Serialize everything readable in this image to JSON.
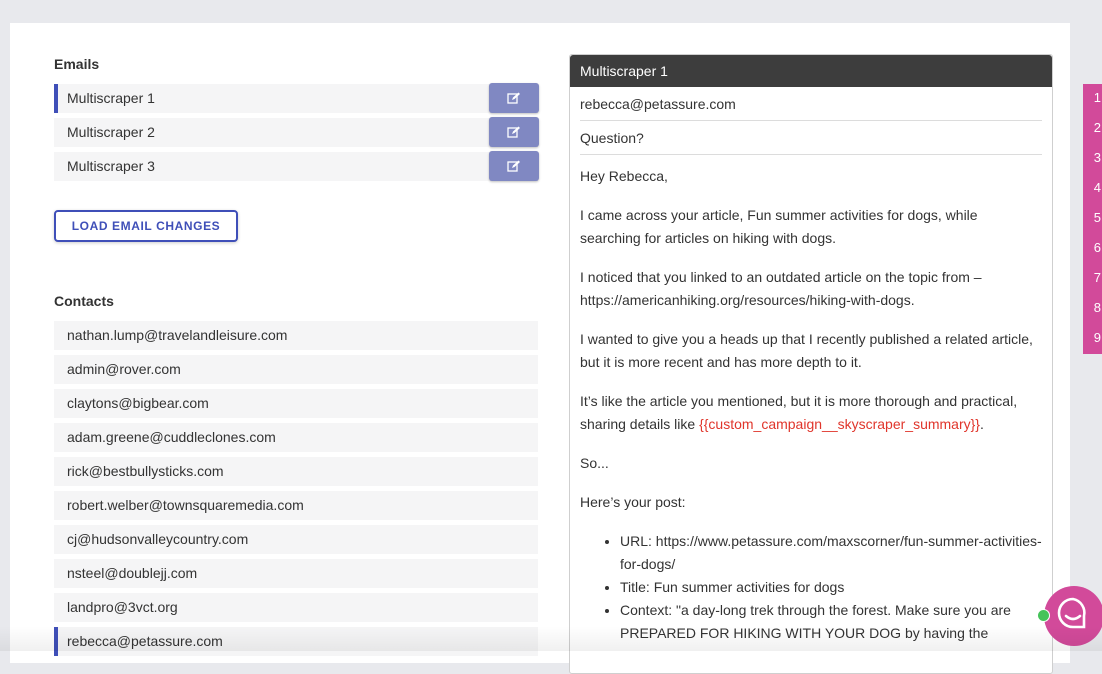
{
  "emails": {
    "title": "Emails",
    "items": [
      {
        "label": "Multiscraper 1"
      },
      {
        "label": "Multiscraper 2"
      },
      {
        "label": "Multiscraper 3"
      }
    ],
    "load_button": "LOAD EMAIL CHANGES"
  },
  "contacts": {
    "title": "Contacts",
    "items": [
      "nathan.lump@travelandleisure.com",
      "admin@rover.com",
      "claytons@bigbear.com",
      "adam.greene@cuddleclones.com",
      "rick@bestbullysticks.com",
      "robert.welber@townsquaremedia.com",
      "cj@hudsonvalleycountry.com",
      "nsteel@doublejj.com",
      "landpro@3vct.org",
      "rebecca@petassure.com"
    ]
  },
  "preview": {
    "header": "Multiscraper 1",
    "to": "rebecca@petassure.com",
    "subject": "Question?",
    "greeting": "Hey Rebecca,",
    "p1": "I came across your article, Fun summer activities for dogs, while searching for articles on hiking with dogs.",
    "p2": "I noticed that you linked to an outdated article on the topic from – https://americanhiking.org/resources/hiking-with-dogs.",
    "p3": "I wanted to give you a heads up that I recently published a related article, but it is more recent and has more depth to it.",
    "p4_text": "It’s like the article you mentioned, but it is more thorough and practical, sharing details like ",
    "p4_var": "{{custom_campaign__skyscraper_summary}}",
    "p4_end": ".",
    "p5": "So...",
    "p6": "Here’s your post:",
    "bullets": [
      "URL: https://www.petassure.com/maxscorner/fun-summer-activities-for-dogs/",
      "Title: Fun summer activities for dogs",
      "Context: \"a day-long trek through the forest. Make sure you are PREPARED FOR HIKING WITH YOUR DOG by having the"
    ]
  },
  "side_numbers": [
    "1",
    "2",
    "3",
    "4",
    "5",
    "6",
    "7",
    "8",
    "9"
  ],
  "colors": {
    "accent": "#3f4fb8",
    "edit_button": "#8088c2",
    "header_dark": "#3d3d3d",
    "pink": "#d24a9a",
    "variable": "#e0352b",
    "online": "#45c35a"
  },
  "icons": {
    "edit": "edit-icon",
    "chat": "chat-icon"
  }
}
